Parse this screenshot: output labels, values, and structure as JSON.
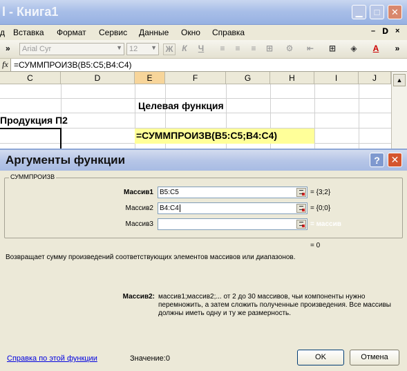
{
  "window": {
    "title": "l - Книга1"
  },
  "menu": {
    "items": [
      "д",
      "Вставка",
      "Формат",
      "Сервис",
      "Данные",
      "Окно",
      "Справка"
    ],
    "doc_controls": [
      "–",
      "ᗞ",
      "×"
    ]
  },
  "toolbar": {
    "font_name": "Arial Cyr",
    "font_size": "12",
    "bold": "Ж",
    "italic": "К",
    "underline": "Ч"
  },
  "formula_bar": {
    "fx": "fx",
    "text": "=СУММПРОИЗВ(B5:C5;B4:C4)"
  },
  "columns": [
    "C",
    "D",
    "E",
    "F",
    "G",
    "H",
    "I",
    "J"
  ],
  "sheet": {
    "target_label": "Целевая функция",
    "product_label": "Продукция П2",
    "formula_cell": "=СУММПРОИЗВ(B5:C5;B4:C4)"
  },
  "dialog": {
    "title": "Аргументы функции",
    "help_btn": "?",
    "close_btn": "✕",
    "group_label": "СУММПРОИЗВ",
    "args": [
      {
        "label": "Массив1",
        "value": "B5:C5",
        "result": "= {3;2}",
        "bold": true
      },
      {
        "label": "Массив2",
        "value": "B4:C4",
        "result": "= {0;0}",
        "bold": false
      },
      {
        "label": "Массив3",
        "value": "",
        "result": "= массив",
        "bold": false
      }
    ],
    "result": "= 0",
    "description": "Возвращает сумму произведений соответствующих элементов массивов или диапазонов.",
    "detail_label": "Массив2:",
    "detail_text": "массив1;массив2;... от 2 до 30 массивов, чьи компоненты нужно перемножить, а затем сложить полученные произведения. Все массивы должны иметь одну и ту же размерность.",
    "help_link": "Справка по этой функции",
    "value_label": "Значение:",
    "value": "0",
    "ok": "OK",
    "cancel": "Отмена"
  },
  "colors": {
    "accent": "#ffff99",
    "selected_header": "#f7d59a"
  }
}
